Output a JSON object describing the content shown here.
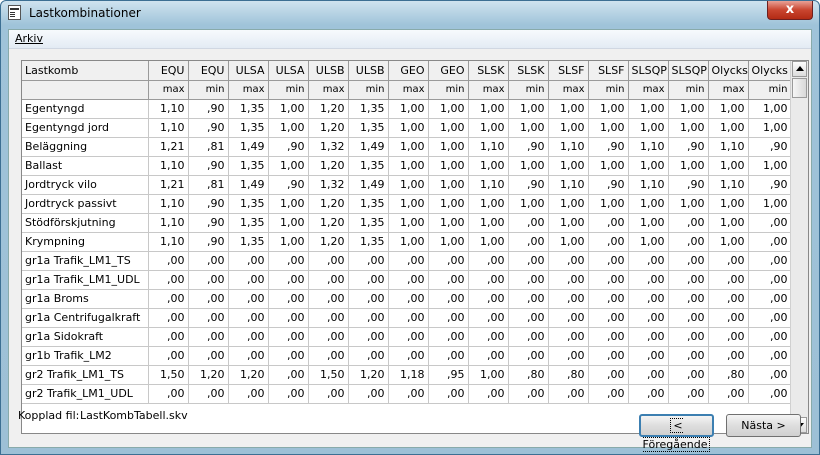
{
  "window": {
    "title": "Lastkombinationer",
    "close_label": "x"
  },
  "menu": {
    "arkiv": "Arkiv"
  },
  "table": {
    "header": [
      "Lastkomb",
      "EQU",
      "EQU",
      "ULSA",
      "ULSA",
      "ULSB",
      "ULSB",
      "GEO",
      "GEO",
      "SLSK",
      "SLSK",
      "SLSF",
      "SLSF",
      "SLSQP",
      "SLSQP",
      "Olycks",
      "Olycks"
    ],
    "subheader": [
      "",
      "max",
      "min",
      "max",
      "min",
      "max",
      "min",
      "max",
      "min",
      "max",
      "min",
      "max",
      "min",
      "max",
      "min",
      "max",
      "min"
    ],
    "rows": [
      [
        "Egentyngd",
        "1,10",
        ",90",
        "1,35",
        "1,00",
        "1,20",
        "1,35",
        "1,00",
        "1,00",
        "1,00",
        "1,00",
        "1,00",
        "1,00",
        "1,00",
        "1,00",
        "1,00",
        "1,00"
      ],
      [
        "Egentyngd jord",
        "1,10",
        ",90",
        "1,35",
        "1,00",
        "1,20",
        "1,35",
        "1,00",
        "1,00",
        "1,00",
        "1,00",
        "1,00",
        "1,00",
        "1,00",
        "1,00",
        "1,00",
        "1,00"
      ],
      [
        "Beläggning",
        "1,21",
        ",81",
        "1,49",
        ",90",
        "1,32",
        "1,49",
        "1,00",
        "1,00",
        "1,10",
        ",90",
        "1,10",
        ",90",
        "1,10",
        ",90",
        "1,10",
        ",90"
      ],
      [
        "Ballast",
        "1,10",
        ",90",
        "1,35",
        "1,00",
        "1,20",
        "1,35",
        "1,00",
        "1,00",
        "1,00",
        "1,00",
        "1,00",
        "1,00",
        "1,00",
        "1,00",
        "1,00",
        "1,00"
      ],
      [
        "Jordtryck vilo",
        "1,21",
        ",81",
        "1,49",
        ",90",
        "1,32",
        "1,49",
        "1,00",
        "1,00",
        "1,10",
        ",90",
        "1,10",
        ",90",
        "1,10",
        ",90",
        "1,10",
        ",90"
      ],
      [
        "Jordtryck passivt",
        "1,10",
        ",90",
        "1,35",
        "1,00",
        "1,20",
        "1,35",
        "1,00",
        "1,00",
        "1,00",
        "1,00",
        "1,00",
        "1,00",
        "1,00",
        "1,00",
        "1,00",
        "1,00"
      ],
      [
        "Stödförskjutning",
        "1,10",
        ",90",
        "1,35",
        "1,00",
        "1,20",
        "1,35",
        "1,00",
        "1,00",
        "1,00",
        ",00",
        "1,00",
        ",00",
        "1,00",
        ",00",
        "1,00",
        ",00"
      ],
      [
        "Krympning",
        "1,10",
        ",90",
        "1,35",
        "1,00",
        "1,20",
        "1,35",
        "1,00",
        "1,00",
        "1,00",
        ",00",
        "1,00",
        ",00",
        "1,00",
        ",00",
        "1,00",
        ",00"
      ],
      [
        "gr1a Trafik_LM1_TS",
        ",00",
        ",00",
        ",00",
        ",00",
        ",00",
        ",00",
        ",00",
        ",00",
        ",00",
        ",00",
        ",00",
        ",00",
        ",00",
        ",00",
        ",00",
        ",00"
      ],
      [
        "gr1a Trafik_LM1_UDL",
        ",00",
        ",00",
        ",00",
        ",00",
        ",00",
        ",00",
        ",00",
        ",00",
        ",00",
        ",00",
        ",00",
        ",00",
        ",00",
        ",00",
        ",00",
        ",00"
      ],
      [
        "gr1a Broms",
        ",00",
        ",00",
        ",00",
        ",00",
        ",00",
        ",00",
        ",00",
        ",00",
        ",00",
        ",00",
        ",00",
        ",00",
        ",00",
        ",00",
        ",00",
        ",00"
      ],
      [
        "gr1a Centrifugalkraft",
        ",00",
        ",00",
        ",00",
        ",00",
        ",00",
        ",00",
        ",00",
        ",00",
        ",00",
        ",00",
        ",00",
        ",00",
        ",00",
        ",00",
        ",00",
        ",00"
      ],
      [
        "gr1a Sidokraft",
        ",00",
        ",00",
        ",00",
        ",00",
        ",00",
        ",00",
        ",00",
        ",00",
        ",00",
        ",00",
        ",00",
        ",00",
        ",00",
        ",00",
        ",00",
        ",00"
      ],
      [
        "gr1b Trafik_LM2",
        ",00",
        ",00",
        ",00",
        ",00",
        ",00",
        ",00",
        ",00",
        ",00",
        ",00",
        ",00",
        ",00",
        ",00",
        ",00",
        ",00",
        ",00",
        ",00"
      ],
      [
        "gr2 Trafik_LM1_TS",
        "1,50",
        "1,20",
        "1,20",
        ",00",
        "1,50",
        "1,20",
        "1,18",
        ",95",
        "1,00",
        ",80",
        ",80",
        ",00",
        ",00",
        ",00",
        ",80",
        ",00"
      ],
      [
        "gr2 Trafik_LM1_UDL",
        ",00",
        ",00",
        ",00",
        ",00",
        ",00",
        ",00",
        ",00",
        ",00",
        ",00",
        ",00",
        ",00",
        ",00",
        ",00",
        ",00",
        ",00",
        ",00"
      ]
    ]
  },
  "footer": {
    "file_label": "Kopplad fil:",
    "file_name": "LastKombTabell.skv",
    "prev_button": "< Föregående",
    "next_button": "Nästa >"
  }
}
